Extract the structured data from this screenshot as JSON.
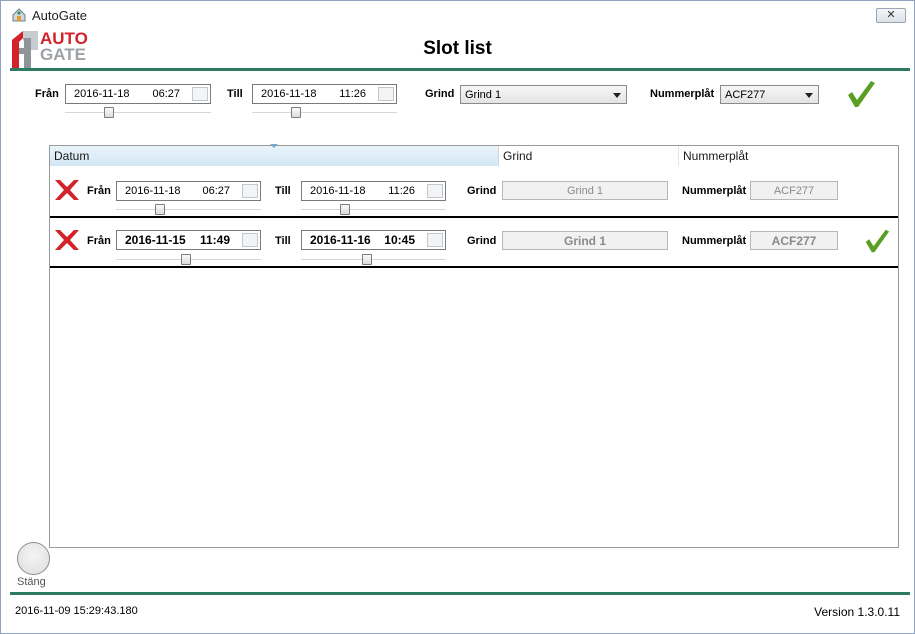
{
  "window": {
    "title": "AutoGate",
    "close_label": "✕"
  },
  "logo": {
    "line1": "AUTO",
    "line2": "GATE"
  },
  "page_title": "Slot list",
  "filter": {
    "from_label": "Från",
    "from_date": "2016-11-18",
    "from_time": "06:27",
    "from_slider": 0.29,
    "till_label": "Till",
    "till_date": "2016-11-18",
    "till_time": "11:26",
    "till_slider": 0.29,
    "grind_label": "Grind",
    "grind_value": "Grind 1",
    "plate_label": "Nummerplåt",
    "plate_value": "ACF277",
    "apply_icon": "check-icon"
  },
  "list": {
    "columns": [
      "Datum",
      "Grind",
      "Nummerplåt"
    ],
    "rows": [
      {
        "delete_icon": "x-icon",
        "from_label": "Från",
        "from_date": "2016-11-18",
        "from_time": "06:27",
        "from_slider": 0.29,
        "till_label": "Till",
        "till_date": "2016-11-18",
        "till_time": "11:26",
        "till_slider": 0.29,
        "grind_label": "Grind",
        "grind_value": "Grind 1",
        "plate_label": "Nummerplåt",
        "plate_value": "ACF277",
        "bold": false,
        "confirmed": false
      },
      {
        "delete_icon": "x-icon",
        "from_label": "Från",
        "from_date": "2016-11-15",
        "from_time": "11:49",
        "from_slider": 0.48,
        "till_label": "Till",
        "till_date": "2016-11-16",
        "till_time": "10:45",
        "till_slider": 0.45,
        "grind_label": "Grind",
        "grind_value": "Grind 1",
        "plate_label": "Nummerplåt",
        "plate_value": "ACF277",
        "bold": true,
        "confirmed": true
      }
    ]
  },
  "close_button_label": "Stäng",
  "footer": {
    "timestamp": "2016-11-09 15:29:43.180",
    "version": "Version 1.3.0.11"
  },
  "colors": {
    "accent": "#2e7a60",
    "check": "#5a9e24",
    "delete": "#d3222a",
    "brand": "#d3222a"
  }
}
